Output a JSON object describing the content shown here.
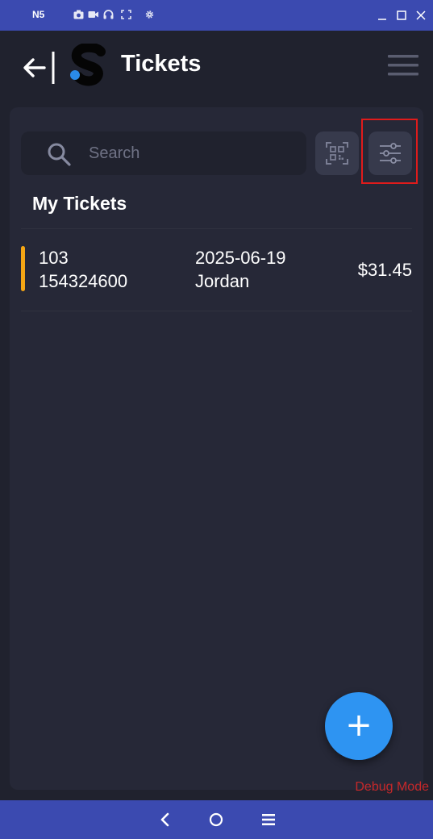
{
  "window": {
    "device_name": "N5",
    "tools": [
      "camera-icon",
      "video-icon",
      "headset-icon",
      "fullscreen-icon",
      "settings-icon"
    ],
    "controls": [
      "minimize-icon",
      "maximize-icon",
      "close-icon"
    ],
    "bar_color": "#3b4ab0"
  },
  "header": {
    "title": "Tickets",
    "back_icon": "back-arrow-icon",
    "logo_icon": "s-logo",
    "menu_icon": "hamburger-menu-icon"
  },
  "search": {
    "placeholder": "Search",
    "value": ""
  },
  "actions": {
    "qr_icon": "qr-scan-icon",
    "filter_icon": "filter-sliders-icon"
  },
  "section": {
    "title": "My Tickets"
  },
  "tickets": [
    {
      "id": "103",
      "number": "154324600",
      "date": "2025-06-19",
      "customer": "Jordan",
      "amount": "$31.45",
      "status_color": "#f5a614"
    }
  ],
  "fab": {
    "label": "+"
  },
  "debug": {
    "label": "Debug Mode"
  },
  "nav": {
    "items": [
      "back-nav-icon",
      "home-nav-icon",
      "menu-nav-icon"
    ]
  },
  "colors": {
    "background": "#20222e",
    "card": "#262837",
    "accent": "#2e94f2",
    "highlight": "#e01b1b"
  }
}
